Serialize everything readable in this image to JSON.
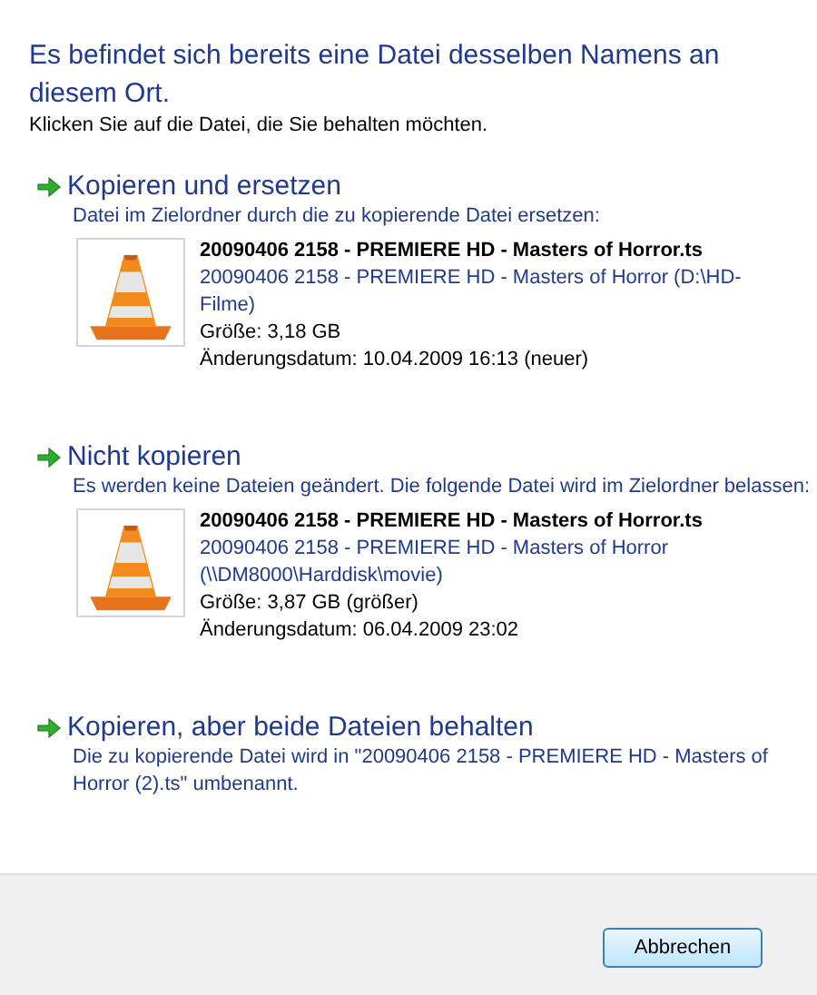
{
  "heading": "Es befindet sich bereits eine Datei desselben Namens an diesem Ort.",
  "instruction": "Klicken Sie auf die Datei, die Sie behalten möchten.",
  "options": [
    {
      "title": "Kopieren und ersetzen",
      "description": "Datei im Zielordner durch die zu kopierende Datei ersetzen:",
      "file": {
        "name": "20090406 2158 - PREMIERE HD - Masters of Horror.ts",
        "location": "20090406 2158 - PREMIERE HD - Masters of Horror (D:\\HD-Filme)",
        "size": "Größe: 3,18 GB",
        "modified": "Änderungsdatum: 10.04.2009 16:13 (neuer)"
      }
    },
    {
      "title": "Nicht kopieren",
      "description": "Es werden keine Dateien geändert. Die folgende Datei wird im Zielordner belassen:",
      "file": {
        "name": "20090406 2158 - PREMIERE HD - Masters of Horror.ts",
        "location": "20090406 2158 - PREMIERE HD - Masters of Horror (\\\\DM8000\\Harddisk\\movie)",
        "size": "Größe: 3,87 GB (größer)",
        "modified": "Änderungsdatum: 06.04.2009 23:02"
      }
    },
    {
      "title": "Kopieren, aber beide Dateien behalten",
      "description": "Die zu kopierende Datei wird in \"20090406 2158 - PREMIERE HD - Masters of Horror (2).ts\" umbenannt."
    }
  ],
  "buttons": [
    "Abbrechen"
  ]
}
